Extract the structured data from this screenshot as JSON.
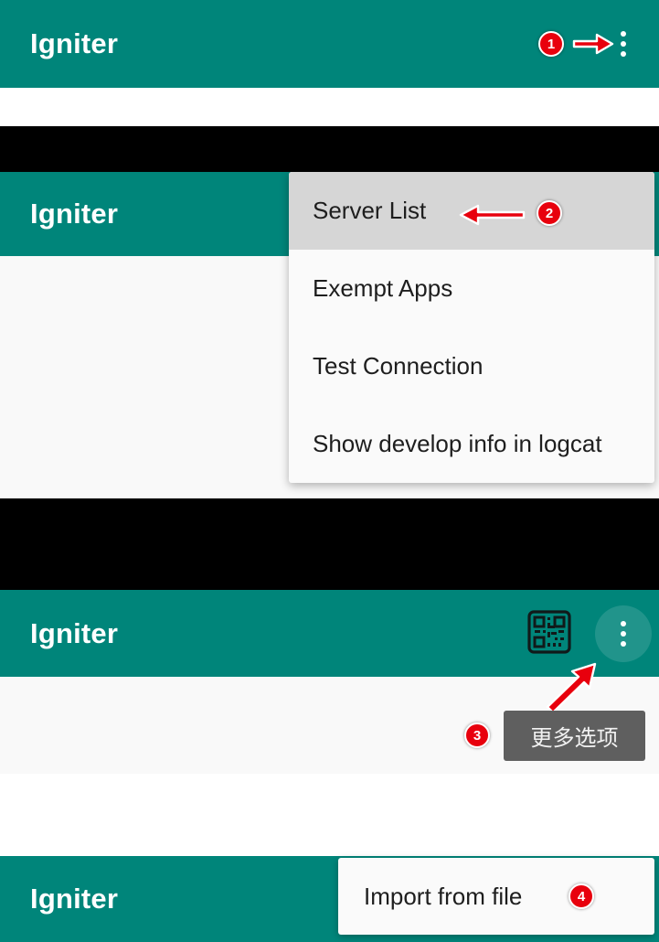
{
  "app": {
    "name": "Igniter",
    "brand_color": "#00857a",
    "badge_color": "#e8000d",
    "arrow_color": "#e8000d"
  },
  "panels": [
    {
      "id": "panel-1",
      "title": "Igniter",
      "overflow_icon": "kebab-menu-icon",
      "badge": "1"
    },
    {
      "id": "panel-2",
      "title": "Igniter",
      "badge": "2",
      "menu": {
        "items": [
          {
            "label": "Server List",
            "selected": true
          },
          {
            "label": "Exempt Apps",
            "selected": false
          },
          {
            "label": "Test Connection",
            "selected": false
          },
          {
            "label": "Show develop info in logcat",
            "selected": false
          }
        ]
      }
    },
    {
      "id": "panel-3",
      "title": "Igniter",
      "badge": "3",
      "qr_icon": "qr-code-icon",
      "overflow_icon": "kebab-menu-icon",
      "tooltip": "更多选项"
    },
    {
      "id": "panel-4",
      "title": "Igniter",
      "badge": "4",
      "popup_item": "Import from file"
    }
  ]
}
